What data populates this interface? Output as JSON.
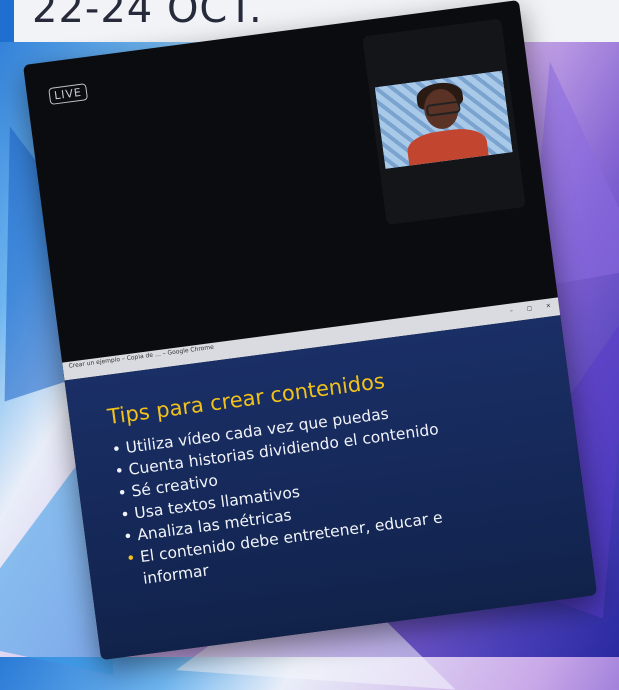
{
  "header": {
    "date_text": "22-24 OCT."
  },
  "screen": {
    "live_label": "LIVE",
    "browser_bar_text": "Crear un ejemplo – Copia de … – Google Chrome",
    "slide": {
      "title": "Tips para crear contenidos",
      "bullets": [
        "Utiliza vídeo cada vez que puedas",
        "Cuenta historias dividiendo el contenido",
        "Sé creativo",
        "Usa textos llamativos",
        "Analiza las métricas",
        "El contenido debe entretener, educar e informar"
      ],
      "last_bullet_line1": "El contenido debe entretener, educar e",
      "last_bullet_line2": "informar"
    }
  },
  "colors": {
    "slide_background": "#1a2f66",
    "title_color": "#f2c21a",
    "bullet_text": "#f1f3f8",
    "accent_blue": "#1f6fd0"
  }
}
